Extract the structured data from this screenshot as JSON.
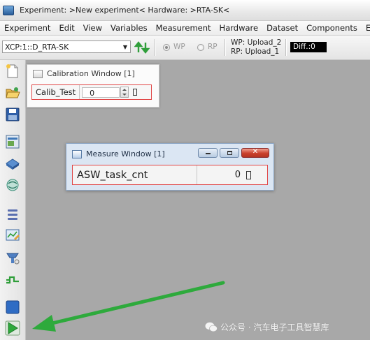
{
  "window": {
    "title": "Experiment: >New experiment< Hardware: >RTA-SK<"
  },
  "menu": [
    "Experiment",
    "Edit",
    "View",
    "Variables",
    "Measurement",
    "Hardware",
    "Dataset",
    "Components",
    "E-"
  ],
  "toolbar": {
    "device": "XCP:1::D_RTA-SK",
    "wp_label": "WP",
    "rp_label": "RP",
    "wp_page": "WP: Upload_2",
    "rp_page": "RP: Upload_1",
    "diff": "Diff.:0"
  },
  "calibration_window": {
    "title": "Calibration Window [1]",
    "variable": "Calib_Test",
    "value": "0"
  },
  "measure_window": {
    "title": "Measure Window [1]",
    "variable": "ASW_task_cnt",
    "value": "0"
  },
  "watermark": "公众号 · 汽车电子工具智慧库",
  "colors": {
    "highlight": "#e04646",
    "arrow": "#2eaa3c",
    "workspace": "#a8a8a8"
  },
  "sidebar_icons": [
    "new-icon",
    "open-icon",
    "save-icon",
    "properties-icon",
    "hardware-icon",
    "network-icon",
    "variable-list-icon",
    "calibration-icon",
    "measure-config-icon",
    "signal-icon",
    "stop-icon",
    "start-measurement-icon"
  ]
}
